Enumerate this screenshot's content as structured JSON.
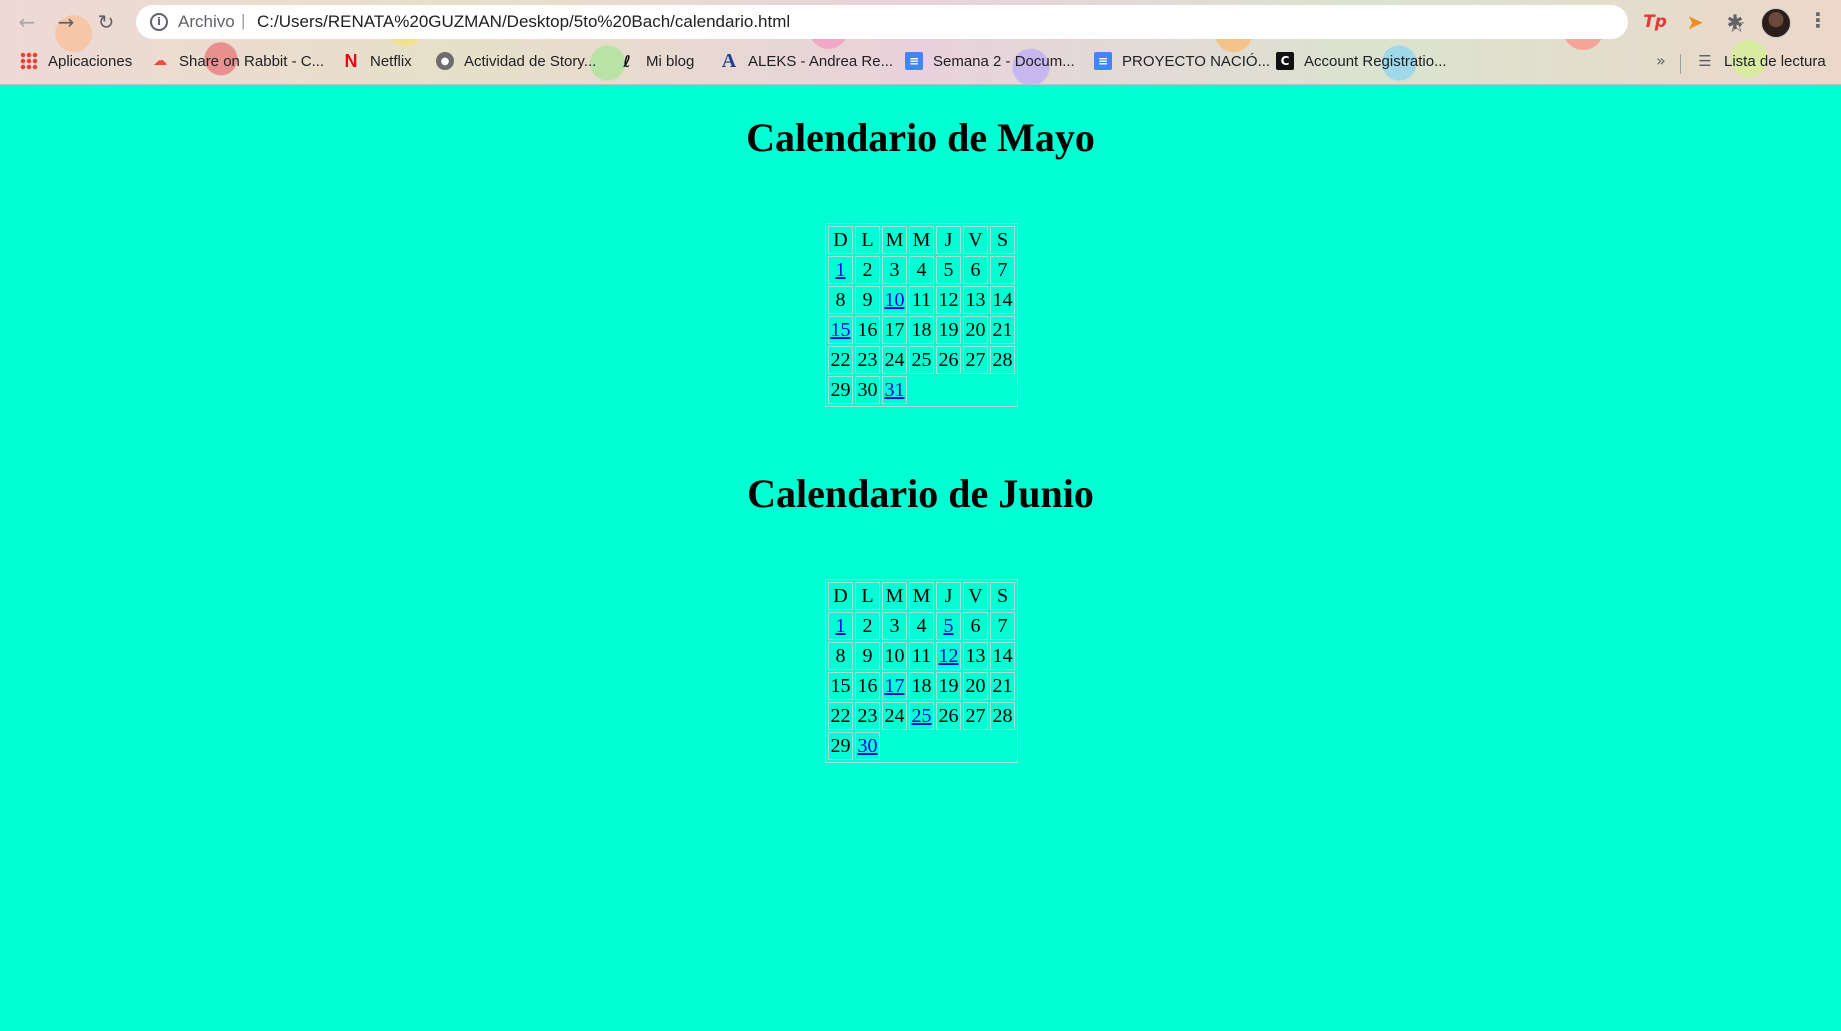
{
  "browser": {
    "back_icon": "arrow-left-icon",
    "forward_icon": "arrow-right-icon",
    "reload_icon": "reload-icon",
    "info_icon": "info-icon",
    "scheme_label": "Archivo",
    "separator": "|",
    "url": "C:/Users/RENATA%20GUZMAN/Desktop/5to%20Bach/calendario.html",
    "star_icon": "star-icon",
    "extensions": [
      "tp-extension-icon",
      "mango-extension-icon",
      "puzzle-icon"
    ],
    "menu_icon": "more-vert-icon"
  },
  "bookmarks": {
    "items": [
      {
        "label": "Aplicaciones",
        "icon": "apps-grid-icon"
      },
      {
        "label": "Share on Rabbit - C...",
        "icon": "rabbit-icon"
      },
      {
        "label": "Netflix",
        "icon": "netflix-icon"
      },
      {
        "label": "Actividad de Story...",
        "icon": "globe-icon"
      },
      {
        "label": "Mi blog",
        "icon": "blog-icon"
      },
      {
        "label": "ALEKS - Andrea Re...",
        "icon": "aleks-icon"
      },
      {
        "label": "Semana 2 - Docum...",
        "icon": "docs-icon"
      },
      {
        "label": "PROYECTO NACIÓ...",
        "icon": "docs-icon"
      },
      {
        "label": "Account Registratio...",
        "icon": "account-icon"
      }
    ],
    "more": "»",
    "reading_list": "Lista de lectura"
  },
  "page": {
    "background": "#00ffd2",
    "link_color": "#0000ee",
    "calendars": [
      {
        "title": "Calendario de Mayo",
        "headers": [
          "D",
          "L",
          "M",
          "M",
          "J",
          "V",
          "S"
        ],
        "weeks": [
          [
            "1",
            "2",
            "3",
            "4",
            "5",
            "6",
            "7"
          ],
          [
            "8",
            "9",
            "10",
            "11",
            "12",
            "13",
            "14"
          ],
          [
            "15",
            "16",
            "17",
            "18",
            "19",
            "20",
            "21"
          ],
          [
            "22",
            "23",
            "24",
            "25",
            "26",
            "27",
            "28"
          ],
          [
            "29",
            "30",
            "31"
          ]
        ],
        "links": [
          "1",
          "10",
          "15",
          "31"
        ]
      },
      {
        "title": "Calendario de Junio",
        "headers": [
          "D",
          "L",
          "M",
          "M",
          "J",
          "V",
          "S"
        ],
        "weeks": [
          [
            "1",
            "2",
            "3",
            "4",
            "5",
            "6",
            "7"
          ],
          [
            "8",
            "9",
            "10",
            "11",
            "12",
            "13",
            "14"
          ],
          [
            "15",
            "16",
            "17",
            "18",
            "19",
            "20",
            "21"
          ],
          [
            "22",
            "23",
            "24",
            "25",
            "26",
            "27",
            "28"
          ],
          [
            "29",
            "30"
          ]
        ],
        "links": [
          "1",
          "5",
          "12",
          "17",
          "25",
          "30"
        ]
      }
    ]
  }
}
